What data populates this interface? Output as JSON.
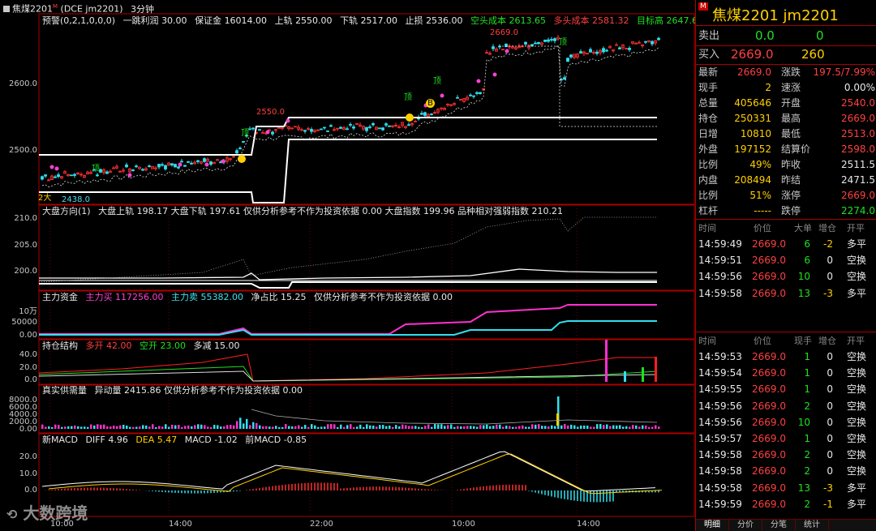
{
  "header": {
    "symbol_title": "焦煤2201",
    "symbol_badge": "M",
    "symbol_code": "(DCE  jm2201)",
    "period": "3分钟"
  },
  "main_panel": {
    "indicator": "预警(0,2,1,0,0,0)",
    "items": [
      {
        "label": "一跳利润",
        "value": "30.00"
      },
      {
        "label": "保证金",
        "value": "16014.00"
      },
      {
        "label": "上轨",
        "value": "2550.00"
      },
      {
        "label": "下轨",
        "value": "2517.00"
      },
      {
        "label": "止损",
        "value": "2536.00"
      }
    ],
    "short_cost": "空头成本 2613.65",
    "long_cost": "多头成本 2581.32",
    "target": "目标高 2647.61",
    "y_ticks": [
      "2600.0",
      "2500.0"
    ],
    "high_label": "2669.0",
    "mid_label": "2550.0",
    "low_label": "2438.0",
    "top_marker": "顶",
    "low_marker": "2大",
    "b_marker": "B"
  },
  "panel2": {
    "indicator": "大盘方向(1)",
    "text": "大盘上轨 198.17   大盘下轨 197.61   仅供分析参考不作为投资依据 0.00   大盘指数 199.96   品种相对强弱指数 210.21",
    "y_ticks": [
      "210.0",
      "205.0",
      "200.0"
    ]
  },
  "panel3": {
    "indicator": "主力资金",
    "buy": "主力买 117256.00",
    "sell": "主力卖 55382.00",
    "ratio": "净占比 15.25",
    "note": "仅供分析参考不作为投资依据 0.00",
    "y_ticks": [
      "10万",
      "50000",
      "0.00"
    ]
  },
  "panel4": {
    "indicator": "持仓结构",
    "long_open": "多开 42.00",
    "short_open": "空开 23.00",
    "reduce": "多减 15.00",
    "y_ticks": [
      "40.0",
      "20.0",
      "0.0"
    ]
  },
  "panel5": {
    "indicator": "真实供需量",
    "text": "异动量 2415.86   仅供分析参考不作为投资依据 0.00",
    "y_ticks": [
      "8000.0",
      "6000.0",
      "4000.0",
      "2000.0",
      "0.00"
    ]
  },
  "panel6": {
    "indicator": "新MACD",
    "diff": "DIFF 4.96",
    "dea": "DEA 5.47",
    "macd": "MACD -1.02",
    "prev": "前MACD -0.85",
    "y_ticks": [
      "20.0",
      "10.0",
      "0.0"
    ]
  },
  "x_ticks": [
    "10:00",
    "14:00",
    "22:00",
    "10:00",
    "14:00"
  ],
  "watermark": "大数跨境",
  "quote": {
    "title": "焦煤2201  jm2201",
    "badge": "M",
    "sell_label": "卖出",
    "sell_price": "0.0",
    "sell_vol": "0",
    "buy_label": "买入",
    "buy_price": "2669.0",
    "buy_vol": "260",
    "rows": [
      {
        "l1": "最新",
        "v1": "2669.0",
        "l2": "涨跌",
        "v2": "197.5/7.99%"
      },
      {
        "l1": "现手",
        "v1": "2",
        "l2": "速涨",
        "v2": "0.00%"
      },
      {
        "l1": "总量",
        "v1": "405646",
        "l2": "开盘",
        "v2": "2540.0"
      },
      {
        "l1": "持仓",
        "v1": "250331",
        "l2": "最高",
        "v2": "2669.0"
      },
      {
        "l1": "日增",
        "v1": "10810",
        "l2": "最低",
        "v2": "2513.0"
      },
      {
        "l1": "外盘",
        "v1": "197152",
        "l2": "结算价",
        "v2": "2598.0"
      },
      {
        "l1": "比例",
        "v1": "49%",
        "l2": "昨收",
        "v2": "2511.5"
      },
      {
        "l1": "内盘",
        "v1": "208494",
        "l2": "昨结",
        "v2": "2471.5"
      },
      {
        "l1": "比例",
        "v1": "51%",
        "l2": "涨停",
        "v2": "2669.0"
      },
      {
        "l1": "杠杆",
        "v1": "-----",
        "l2": "跌停",
        "v2": "2274.0"
      }
    ]
  },
  "big_trades": {
    "headers": [
      "时间",
      "价位",
      "大单",
      "增仓",
      "开平"
    ],
    "rows": [
      [
        "14:59:49",
        "2669.0",
        "6",
        "-2",
        "多平"
      ],
      [
        "14:59:51",
        "2669.0",
        "6",
        "0",
        "空换"
      ],
      [
        "14:59:56",
        "2669.0",
        "10",
        "0",
        "空换"
      ],
      [
        "14:59:58",
        "2669.0",
        "13",
        "-3",
        "多平"
      ]
    ]
  },
  "ticks": {
    "headers": [
      "时间",
      "价位",
      "现手",
      "增仓",
      "开平"
    ],
    "rows": [
      [
        "14:59:53",
        "2669.0",
        "1",
        "0",
        "空换"
      ],
      [
        "14:59:54",
        "2669.0",
        "1",
        "0",
        "空换"
      ],
      [
        "14:59:55",
        "2669.0",
        "1",
        "0",
        "空换"
      ],
      [
        "14:59:56",
        "2669.0",
        "2",
        "0",
        "空换"
      ],
      [
        "14:59:56",
        "2669.0",
        "10",
        "0",
        "空换"
      ],
      [
        "14:59:57",
        "2669.0",
        "1",
        "0",
        "空换"
      ],
      [
        "14:59:58",
        "2669.0",
        "2",
        "0",
        "空换"
      ],
      [
        "14:59:58",
        "2669.0",
        "2",
        "0",
        "空换"
      ],
      [
        "14:59:58",
        "2669.0",
        "13",
        "-3",
        "多平"
      ],
      [
        "14:59:59",
        "2669.0",
        "2",
        "-1",
        "多平"
      ]
    ]
  },
  "tabs": [
    "明细",
    "分价",
    "分笔",
    "统计"
  ]
}
